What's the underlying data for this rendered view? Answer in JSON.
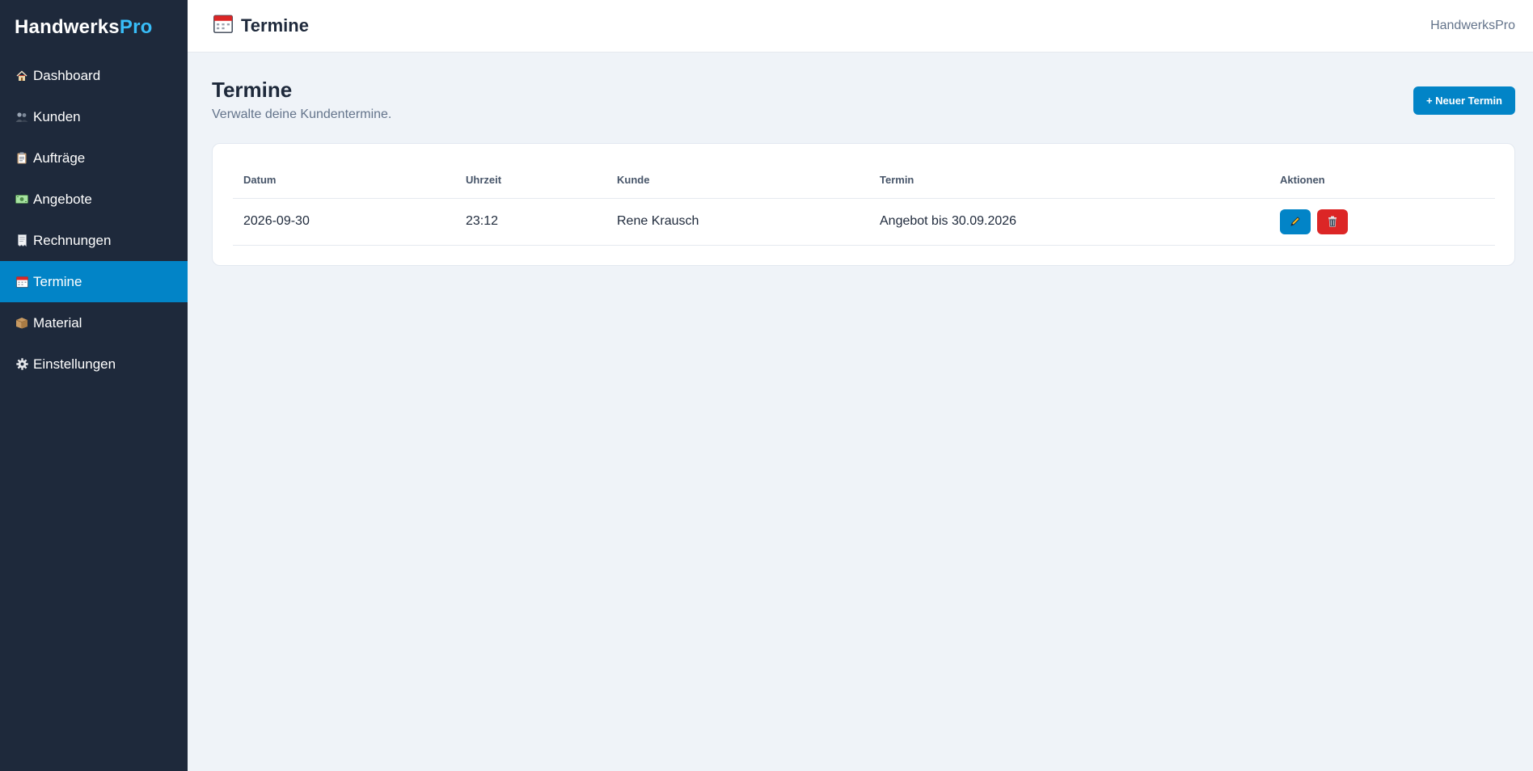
{
  "sidebar": {
    "brand": {
      "main": "Handwerks",
      "accent": "Pro"
    },
    "items": [
      {
        "label": "Dashboard",
        "icon": "house-icon"
      },
      {
        "label": "Kunden",
        "icon": "people-icon"
      },
      {
        "label": "Aufträge",
        "icon": "clipboard-icon"
      },
      {
        "label": "Angebote",
        "icon": "money-icon"
      },
      {
        "label": "Rechnungen",
        "icon": "receipt-icon"
      },
      {
        "label": "Termine",
        "icon": "calendar-icon",
        "active": true
      },
      {
        "label": "Material",
        "icon": "box-icon"
      },
      {
        "label": "Einstellungen",
        "icon": "gear-icon"
      }
    ]
  },
  "topbar": {
    "title": "Termine",
    "brand": "HandwerksPro"
  },
  "page": {
    "title": "Termine",
    "subtitle": "Verwalte deine Kundentermine.",
    "new_button": "+ Neuer Termin"
  },
  "table": {
    "headers": [
      "Datum",
      "Uhrzeit",
      "Kunde",
      "Termin",
      "Aktionen"
    ],
    "rows": [
      {
        "datum": "2026-09-30",
        "uhrzeit": "23:12",
        "kunde": "Rene Krausch",
        "termin": "Angebot bis 30.09.2026"
      }
    ]
  },
  "colors": {
    "sidebar": "#1e293b",
    "accent": "#0284c7",
    "brand_accent": "#38bdf8",
    "danger": "#dc2626"
  }
}
